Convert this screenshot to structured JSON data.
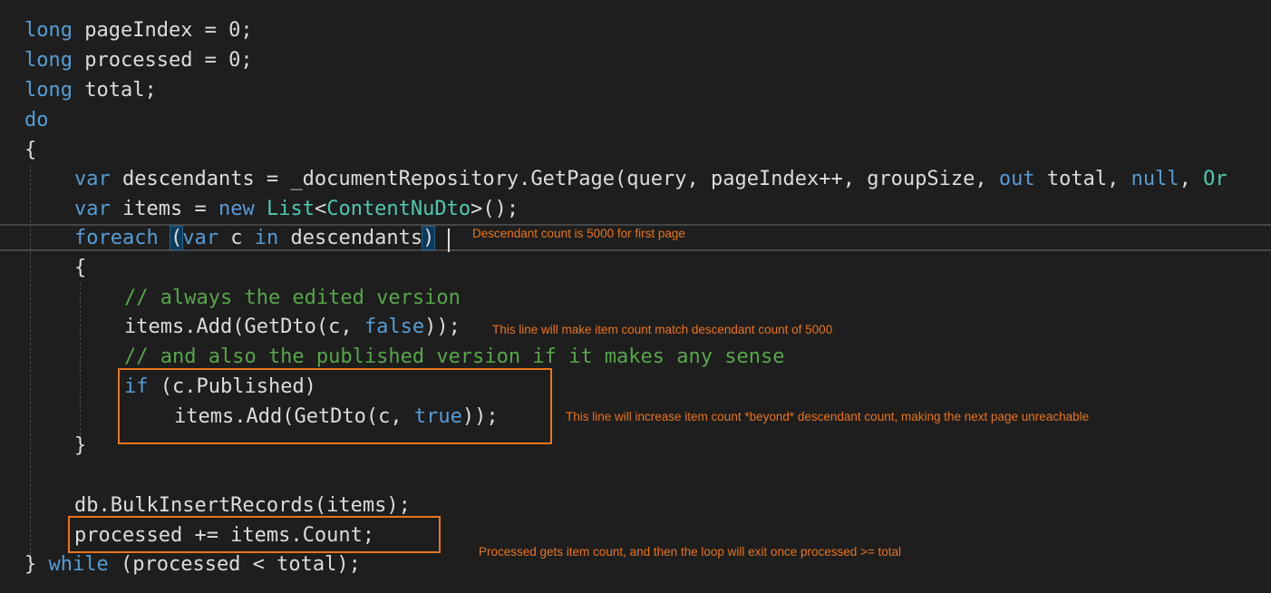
{
  "code": {
    "l1": {
      "kw": "long",
      "rest": " pageIndex = ",
      "num": "0",
      "end": ";"
    },
    "l2": {
      "kw": "long",
      "rest": " processed = ",
      "num": "0",
      "end": ";"
    },
    "l3": {
      "kw": "long",
      "rest": " total;"
    },
    "l4": {
      "kw": "do"
    },
    "l5": {
      "text": "{"
    },
    "l6": {
      "kw": "var",
      "a": " descendants = _documentRepository.GetPage(query, pageIndex++, groupSize, ",
      "kw2": "out",
      "b": " total, ",
      "kw3": "null",
      "c": ", ",
      "kw4": "Or"
    },
    "l7": {
      "kw": "var",
      "a": " items = ",
      "kw2": "new",
      "b": " ",
      "type": "List",
      "c": "<",
      "type2": "ContentNuDto",
      "d": ">();"
    },
    "l8": {
      "kw": "foreach",
      "sp": " ",
      "paren": "(",
      "kw2": "var",
      "a": " c ",
      "kw3": "in",
      "b": " descendants",
      "paren2": ")"
    },
    "l9": {
      "text": "{"
    },
    "l10": {
      "comment": "// always the edited version"
    },
    "l11": {
      "a": "items.Add(GetDto(c, ",
      "kw": "false",
      "b": "));"
    },
    "l12": {
      "comment": "// and also the published version if it makes any sense"
    },
    "l13": {
      "kw": "if",
      "a": " (c.Published)"
    },
    "l14": {
      "a": "items.Add(GetDto(c, ",
      "kw": "true",
      "b": "));"
    },
    "l15": {
      "text": "}"
    },
    "l16": {
      "text": "db.BulkInsertRecords(items);"
    },
    "l17": {
      "text": "processed += items.Count;"
    },
    "l18": {
      "a": "} ",
      "kw": "while",
      "b": " (processed < total);"
    }
  },
  "annotations": {
    "note1": "Descendant count is 5000 for first page",
    "note2": "This line will make item count match descendant count of 5000",
    "note3": "This line will increase item count *beyond* descendant count, making the next page unreachable",
    "note4": "Processed gets item count, and then the loop will exit once processed >= total"
  },
  "colors": {
    "background": "#1e1e1e",
    "keyword": "#569cd6",
    "type": "#4ec9b0",
    "comment": "#57a64a",
    "text": "#dcdcdc",
    "annotation": "#e8741c"
  }
}
